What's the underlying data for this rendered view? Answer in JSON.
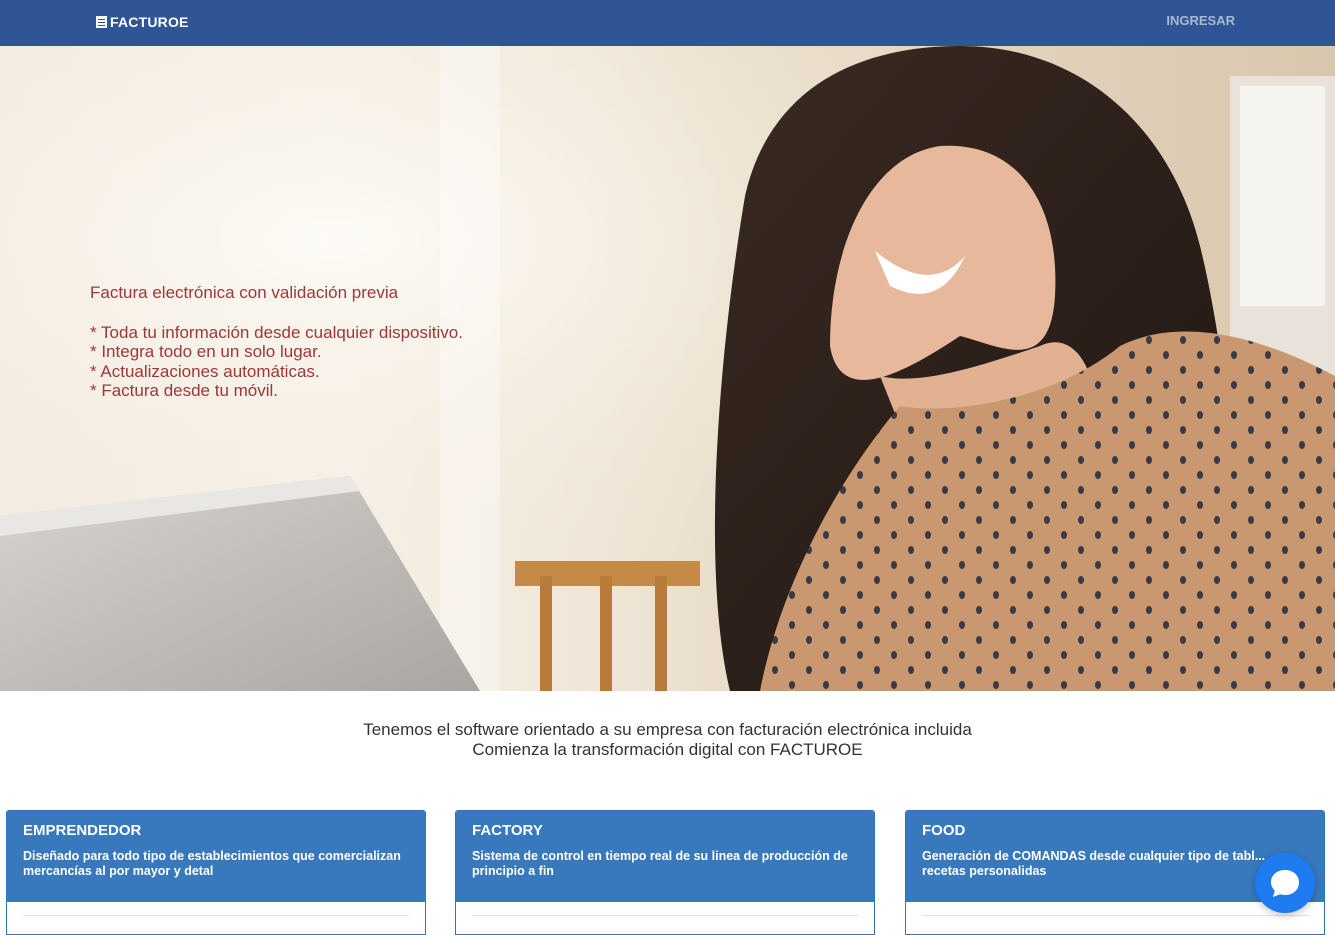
{
  "header": {
    "logo_text": "FACTUROE",
    "login_label": "INGRESAR"
  },
  "hero": {
    "headline": "Factura electrónica con validación previa",
    "bullets": [
      "* Toda tu información desde cualquier dispositivo.",
      "* Integra todo en un solo lugar.",
      "* Actualizaciones automáticas.",
      "* Factura desde tu móvil."
    ]
  },
  "tagline": {
    "line1": "Tenemos el software orientado a su empresa con facturación electrónica incluida",
    "line2": "Comienza la transformación digital con FACTUROE"
  },
  "plans": [
    {
      "title": "EMPRENDEDOR",
      "description": "Diseñado para todo tipo de establecimientos que comercializan mercancías al por mayor y detal"
    },
    {
      "title": "FACTORY",
      "description": "Sistema de control en tiempo real de su linea de producción de principio a fin"
    },
    {
      "title": "FOOD",
      "description": "Generación de COMANDAS desde cualquier tipo de tabl... recetas personalidas"
    }
  ],
  "chat": {
    "icon": "chat-bubble-icon"
  },
  "colors": {
    "nav": "#2f5597",
    "accent": "#3879bd",
    "hero_text": "#9c3838",
    "chat": "#1f7bf0"
  }
}
